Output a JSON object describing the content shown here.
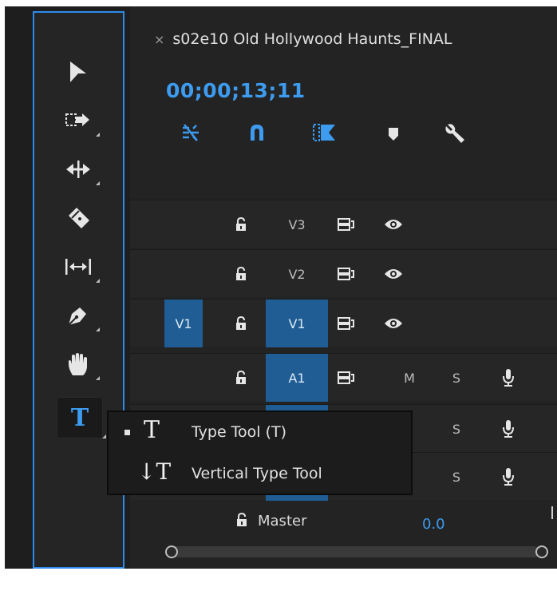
{
  "sequence": {
    "close_label": "×",
    "title": "s02e10 Old Hollywood Haunts_FINAL"
  },
  "timecode": "00;00;13;11",
  "colors": {
    "accent": "#3d9bf0",
    "track_patch": "#1f5d94",
    "panel_border": "#2d8ceb"
  },
  "tools": [
    {
      "name": "selection-tool",
      "icon": "arrow-icon"
    },
    {
      "name": "track-select-forward-tool",
      "icon": "track-select-icon"
    },
    {
      "name": "ripple-edit-tool",
      "icon": "ripple-edit-icon"
    },
    {
      "name": "razor-tool",
      "icon": "razor-icon"
    },
    {
      "name": "slip-tool",
      "icon": "slip-icon"
    },
    {
      "name": "pen-tool",
      "icon": "pen-icon"
    },
    {
      "name": "hand-tool",
      "icon": "hand-icon"
    },
    {
      "name": "type-tool",
      "icon": "type-icon",
      "glyph": "T"
    }
  ],
  "timeline_controls": [
    {
      "name": "insert-overwrite-icon"
    },
    {
      "name": "snap-icon"
    },
    {
      "name": "linked-selection-icon"
    },
    {
      "name": "add-marker-icon"
    },
    {
      "name": "settings-wrench-icon"
    }
  ],
  "tracks": {
    "video": [
      {
        "source": "",
        "label": "V3"
      },
      {
        "source": "",
        "label": "V2"
      },
      {
        "source": "V1",
        "label": "V1"
      }
    ],
    "audio": [
      {
        "label": "A1",
        "mute": "M",
        "solo": "S"
      },
      {
        "label": "",
        "mute": "",
        "solo": "S"
      },
      {
        "label": "",
        "mute": "",
        "solo": "S"
      }
    ]
  },
  "master": {
    "label": "Master",
    "value": "0.0"
  },
  "flyout": {
    "items": [
      {
        "glyph": "T",
        "label": "Type Tool (T)",
        "selected": true
      },
      {
        "glyph": "↓T",
        "label": "Vertical Type Tool",
        "selected": false
      }
    ]
  }
}
